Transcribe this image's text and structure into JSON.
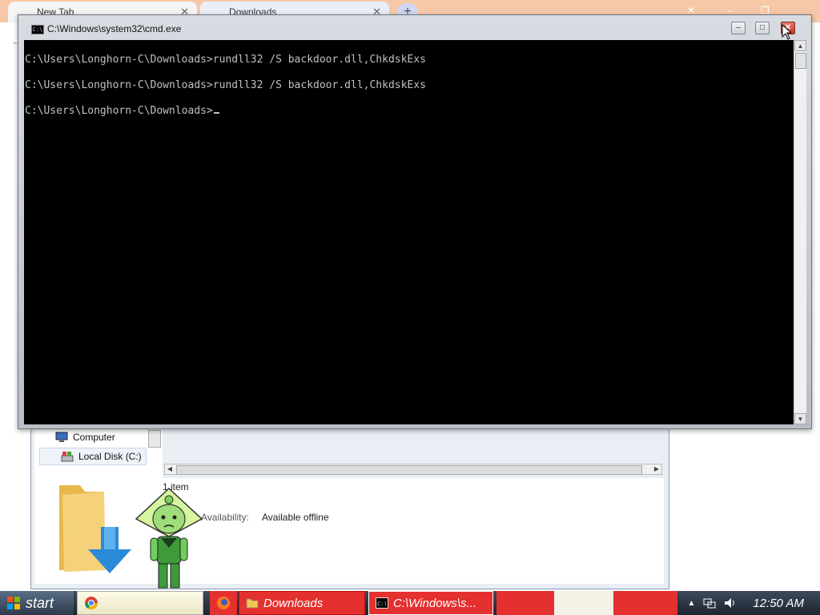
{
  "background_browser": {
    "tabs": [
      {
        "label": "New Tab"
      },
      {
        "label": "Downloads"
      }
    ],
    "new_tab_symbol": "+"
  },
  "cmd": {
    "title": "C:\\Windows\\system32\\cmd.exe",
    "buttons": {
      "minimize": "–",
      "maximize": "□",
      "close": "✕"
    },
    "lines": [
      "C:\\Users\\Longhorn-C\\Downloads>rundll32 /S backdoor.dll,ChkdskExs",
      "C:\\Users\\Longhorn-C\\Downloads>rundll32 /S backdoor.dll,ChkdskExs",
      "C:\\Users\\Longhorn-C\\Downloads>"
    ]
  },
  "explorer": {
    "nav_items": [
      {
        "label": "Computer",
        "icon": "computer-icon"
      },
      {
        "label": "Local Disk (C:)",
        "icon": "local-disk-icon"
      }
    ],
    "details": {
      "item_count": "1 item",
      "availability_label": "Availability:",
      "availability_value": "Available offline"
    }
  },
  "taskbar": {
    "start_label": "start",
    "buttons": [
      {
        "label": "",
        "icon": "chrome-icon"
      },
      {
        "label": "",
        "icon": "firefox-icon"
      },
      {
        "label": "Downloads",
        "icon": "folder-icon"
      },
      {
        "label": "C:\\Windows\\s...",
        "icon": "cmd-icon"
      }
    ],
    "clock": "12:50 AM"
  },
  "colors": {
    "console_bg": "#000000",
    "console_text": "#c0c0c0",
    "taskbar_active": "#e53030",
    "close_button": "#c2352a"
  }
}
